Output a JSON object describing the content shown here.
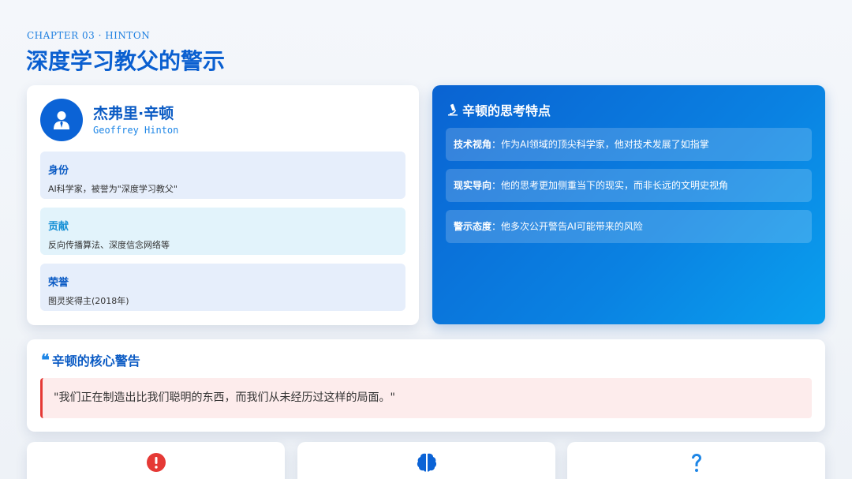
{
  "header": {
    "chapter": "CHAPTER 03 · HINTON",
    "title": "深度学习教父的警示"
  },
  "profile": {
    "name": "杰弗里·辛顿",
    "english_name": "Geoffrey Hinton",
    "avatar_icon": "user-tie-icon",
    "items": [
      {
        "label": "身份",
        "value": "AI科学家，被誉为\"深度学习教父\""
      },
      {
        "label": "贡献",
        "value": "反向传播算法、深度信念网络等"
      },
      {
        "label": "荣誉",
        "value": "图灵奖得主(2018年)"
      }
    ]
  },
  "thinking": {
    "icon": "microscope-icon",
    "title": "辛顿的思考特点",
    "traits": [
      {
        "key": "技术视角",
        "text": "：作为AI领域的顶尖科学家，他对技术发展了如指掌"
      },
      {
        "key": "现实导向",
        "text": "：他的思考更加侧重当下的现实，而非长远的文明史视角"
      },
      {
        "key": "警示态度",
        "text": "：他多次公开警告AI可能带来的风险"
      }
    ]
  },
  "warning": {
    "icon": "quote-icon",
    "title": "辛顿的核心警告",
    "quote": "\"我们正在制造出比我们聪明的东西，而我们从未经历过这样的局面。\""
  },
  "bottom_cards": [
    {
      "icon": "exclamation-circle-icon",
      "color": "#e53935"
    },
    {
      "icon": "brain-icon",
      "color": "#0b63d6"
    },
    {
      "icon": "question-icon",
      "color": "#1e86e6"
    }
  ],
  "colors": {
    "primary": "#0b5bc4",
    "accent": "#1e86e6",
    "danger": "#e53935"
  }
}
